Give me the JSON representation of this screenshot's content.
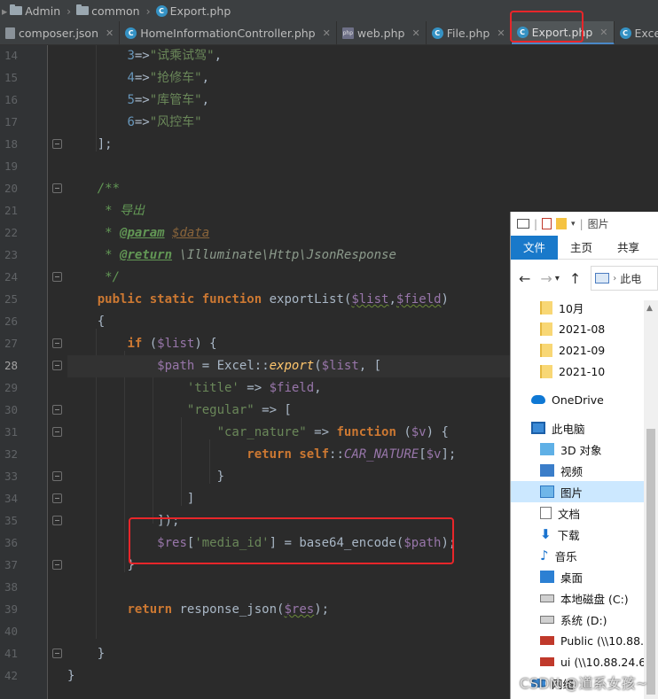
{
  "breadcrumb": [
    {
      "label": "Admin",
      "icon": "folder-icon"
    },
    {
      "label": "common",
      "icon": "folder-icon"
    },
    {
      "label": "Export.php",
      "icon": "php-class-icon"
    }
  ],
  "tabs": [
    {
      "label": "composer.json",
      "icon": "json-file-icon",
      "active": false
    },
    {
      "label": "HomeInformationController.php",
      "icon": "php-class-icon",
      "active": false
    },
    {
      "label": "web.php",
      "icon": "php-file-icon",
      "active": false
    },
    {
      "label": "File.php",
      "icon": "php-class-icon",
      "active": false
    },
    {
      "label": "Export.php",
      "icon": "php-class-icon",
      "active": true
    },
    {
      "label": "Excel.p",
      "icon": "php-class-icon",
      "active": false
    }
  ],
  "editor": {
    "line_numbers": [
      "14",
      "15",
      "16",
      "17",
      "18",
      "19",
      "20",
      "21",
      "22",
      "23",
      "24",
      "25",
      "26",
      "27",
      "28",
      "29",
      "30",
      "31",
      "32",
      "33",
      "34",
      "35",
      "36",
      "37",
      "38",
      "39",
      "40",
      "41",
      "42"
    ],
    "current_line": "28",
    "code": {
      "l14_num": "3",
      "l14_str": "\"试乘试驾\"",
      "l15_num": "4",
      "l15_str": "\"抢修车\"",
      "l16_num": "5",
      "l16_str": "\"库管车\"",
      "l17_num": "6",
      "l17_str": "\"风控车\"",
      "l18": "];",
      "l20": "/**",
      "l21": " * 导出",
      "l22_tag": "@param",
      "l22_var": "$data",
      "l23_tag": "@return",
      "l23_type": "\\Illuminate\\Http\\JsonResponse",
      "l24": " */",
      "l25_mods": "public static function",
      "l25_name": "exportList",
      "l25_p1": "$list",
      "l25_p2": "$field",
      "l26": "{",
      "l27_kw": "if",
      "l27_var": "$list",
      "l28_var": "$path",
      "l28_cls": "Excel",
      "l28_fn": "export",
      "l28_arg": "$list",
      "l29_key": "'title'",
      "l29_var": "$field",
      "l30_key": "\"regular\"",
      "l31_key": "\"car_nature\"",
      "l31_kw": "function",
      "l31_var": "$v",
      "l32_kw": "return",
      "l32_self": "self",
      "l32_const": "CAR_NATURE",
      "l32_var": "$v",
      "l33": "}",
      "l34": "]",
      "l35": "]);",
      "l36_var": "$res",
      "l36_key": "'media_id'",
      "l36_fn": "base64_encode",
      "l36_arg": "$path",
      "l37": "}",
      "l39_kw": "return",
      "l39_fn": "response_json",
      "l39_var": "$res",
      "l41": "}",
      "l42": "}"
    }
  },
  "explorer": {
    "title": "图片",
    "ribbon": [
      "文件",
      "主页",
      "共享"
    ],
    "address": "此电",
    "items": [
      {
        "label": "10月",
        "icon": "folder-icon"
      },
      {
        "label": "2021-08",
        "icon": "folder-icon"
      },
      {
        "label": "2021-09",
        "icon": "folder-icon"
      },
      {
        "label": "2021-10",
        "icon": "folder-icon"
      },
      {
        "label": "OneDrive",
        "icon": "onedrive-icon"
      },
      {
        "label": "此电脑",
        "icon": "computer-icon"
      },
      {
        "label": "3D 对象",
        "icon": "3d-objects-icon"
      },
      {
        "label": "视频",
        "icon": "video-icon"
      },
      {
        "label": "图片",
        "icon": "pictures-icon"
      },
      {
        "label": "文档",
        "icon": "documents-icon"
      },
      {
        "label": "下载",
        "icon": "download-icon"
      },
      {
        "label": "音乐",
        "icon": "music-icon"
      },
      {
        "label": "桌面",
        "icon": "desktop-icon"
      },
      {
        "label": "本地磁盘 (C:)",
        "icon": "drive-icon"
      },
      {
        "label": "系统 (D:)",
        "icon": "drive-icon"
      },
      {
        "label": "Public (\\\\10.88.",
        "icon": "network-drive-icon"
      },
      {
        "label": "ui (\\\\10.88.24.6",
        "icon": "network-drive-icon"
      },
      {
        "label": "网络",
        "icon": "network-icon"
      }
    ]
  },
  "watermark": "CSDN @道系女孩~",
  "colors": {
    "highlight_box": "#e8262a",
    "active_tab_underline": "#4a88c7",
    "explorer_file_tab": "#1979ca"
  }
}
